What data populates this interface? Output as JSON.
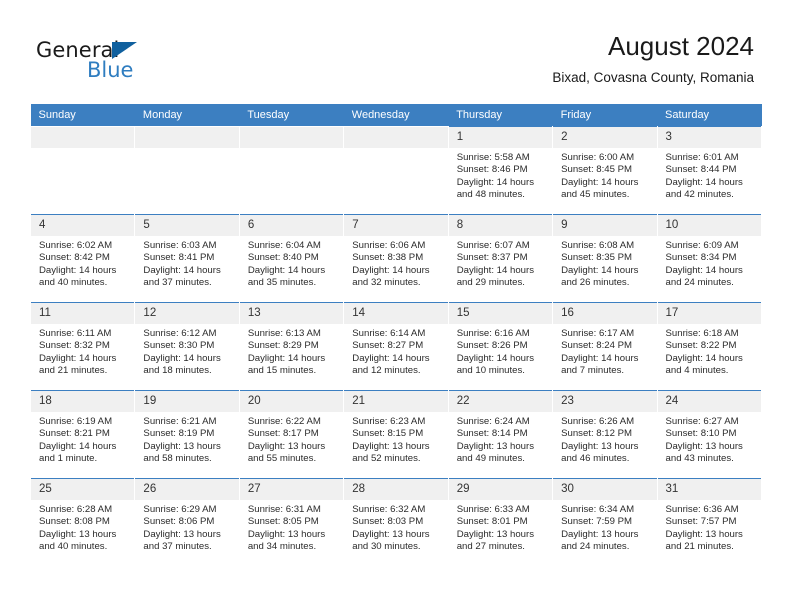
{
  "brand": {
    "name_part1": "General",
    "name_part2": "Blue",
    "logo_icon": "triangle-logo-icon"
  },
  "header": {
    "title": "August 2024",
    "subtitle": "Bixad, Covasna County, Romania"
  },
  "colors": {
    "header_blue": "#3c7fc1",
    "brand_blue": "#2f7dc0",
    "logo_blue": "#10609e",
    "daynum_bg": "#f0f0f0",
    "text": "#2b2b2b"
  },
  "weekdays": [
    "Sunday",
    "Monday",
    "Tuesday",
    "Wednesday",
    "Thursday",
    "Friday",
    "Saturday"
  ],
  "weeks": [
    [
      {
        "day": "",
        "blank": true,
        "sunrise": "",
        "sunset": "",
        "daylight": ""
      },
      {
        "day": "",
        "blank": true,
        "sunrise": "",
        "sunset": "",
        "daylight": ""
      },
      {
        "day": "",
        "blank": true,
        "sunrise": "",
        "sunset": "",
        "daylight": ""
      },
      {
        "day": "",
        "blank": true,
        "sunrise": "",
        "sunset": "",
        "daylight": ""
      },
      {
        "day": "1",
        "sunrise": "Sunrise: 5:58 AM",
        "sunset": "Sunset: 8:46 PM",
        "daylight": "Daylight: 14 hours and 48 minutes."
      },
      {
        "day": "2",
        "sunrise": "Sunrise: 6:00 AM",
        "sunset": "Sunset: 8:45 PM",
        "daylight": "Daylight: 14 hours and 45 minutes."
      },
      {
        "day": "3",
        "sunrise": "Sunrise: 6:01 AM",
        "sunset": "Sunset: 8:44 PM",
        "daylight": "Daylight: 14 hours and 42 minutes."
      }
    ],
    [
      {
        "day": "4",
        "sunrise": "Sunrise: 6:02 AM",
        "sunset": "Sunset: 8:42 PM",
        "daylight": "Daylight: 14 hours and 40 minutes."
      },
      {
        "day": "5",
        "sunrise": "Sunrise: 6:03 AM",
        "sunset": "Sunset: 8:41 PM",
        "daylight": "Daylight: 14 hours and 37 minutes."
      },
      {
        "day": "6",
        "sunrise": "Sunrise: 6:04 AM",
        "sunset": "Sunset: 8:40 PM",
        "daylight": "Daylight: 14 hours and 35 minutes."
      },
      {
        "day": "7",
        "sunrise": "Sunrise: 6:06 AM",
        "sunset": "Sunset: 8:38 PM",
        "daylight": "Daylight: 14 hours and 32 minutes."
      },
      {
        "day": "8",
        "sunrise": "Sunrise: 6:07 AM",
        "sunset": "Sunset: 8:37 PM",
        "daylight": "Daylight: 14 hours and 29 minutes."
      },
      {
        "day": "9",
        "sunrise": "Sunrise: 6:08 AM",
        "sunset": "Sunset: 8:35 PM",
        "daylight": "Daylight: 14 hours and 26 minutes."
      },
      {
        "day": "10",
        "sunrise": "Sunrise: 6:09 AM",
        "sunset": "Sunset: 8:34 PM",
        "daylight": "Daylight: 14 hours and 24 minutes."
      }
    ],
    [
      {
        "day": "11",
        "sunrise": "Sunrise: 6:11 AM",
        "sunset": "Sunset: 8:32 PM",
        "daylight": "Daylight: 14 hours and 21 minutes."
      },
      {
        "day": "12",
        "sunrise": "Sunrise: 6:12 AM",
        "sunset": "Sunset: 8:30 PM",
        "daylight": "Daylight: 14 hours and 18 minutes."
      },
      {
        "day": "13",
        "sunrise": "Sunrise: 6:13 AM",
        "sunset": "Sunset: 8:29 PM",
        "daylight": "Daylight: 14 hours and 15 minutes."
      },
      {
        "day": "14",
        "sunrise": "Sunrise: 6:14 AM",
        "sunset": "Sunset: 8:27 PM",
        "daylight": "Daylight: 14 hours and 12 minutes."
      },
      {
        "day": "15",
        "sunrise": "Sunrise: 6:16 AM",
        "sunset": "Sunset: 8:26 PM",
        "daylight": "Daylight: 14 hours and 10 minutes."
      },
      {
        "day": "16",
        "sunrise": "Sunrise: 6:17 AM",
        "sunset": "Sunset: 8:24 PM",
        "daylight": "Daylight: 14 hours and 7 minutes."
      },
      {
        "day": "17",
        "sunrise": "Sunrise: 6:18 AM",
        "sunset": "Sunset: 8:22 PM",
        "daylight": "Daylight: 14 hours and 4 minutes."
      }
    ],
    [
      {
        "day": "18",
        "sunrise": "Sunrise: 6:19 AM",
        "sunset": "Sunset: 8:21 PM",
        "daylight": "Daylight: 14 hours and 1 minute."
      },
      {
        "day": "19",
        "sunrise": "Sunrise: 6:21 AM",
        "sunset": "Sunset: 8:19 PM",
        "daylight": "Daylight: 13 hours and 58 minutes."
      },
      {
        "day": "20",
        "sunrise": "Sunrise: 6:22 AM",
        "sunset": "Sunset: 8:17 PM",
        "daylight": "Daylight: 13 hours and 55 minutes."
      },
      {
        "day": "21",
        "sunrise": "Sunrise: 6:23 AM",
        "sunset": "Sunset: 8:15 PM",
        "daylight": "Daylight: 13 hours and 52 minutes."
      },
      {
        "day": "22",
        "sunrise": "Sunrise: 6:24 AM",
        "sunset": "Sunset: 8:14 PM",
        "daylight": "Daylight: 13 hours and 49 minutes."
      },
      {
        "day": "23",
        "sunrise": "Sunrise: 6:26 AM",
        "sunset": "Sunset: 8:12 PM",
        "daylight": "Daylight: 13 hours and 46 minutes."
      },
      {
        "day": "24",
        "sunrise": "Sunrise: 6:27 AM",
        "sunset": "Sunset: 8:10 PM",
        "daylight": "Daylight: 13 hours and 43 minutes."
      }
    ],
    [
      {
        "day": "25",
        "sunrise": "Sunrise: 6:28 AM",
        "sunset": "Sunset: 8:08 PM",
        "daylight": "Daylight: 13 hours and 40 minutes."
      },
      {
        "day": "26",
        "sunrise": "Sunrise: 6:29 AM",
        "sunset": "Sunset: 8:06 PM",
        "daylight": "Daylight: 13 hours and 37 minutes."
      },
      {
        "day": "27",
        "sunrise": "Sunrise: 6:31 AM",
        "sunset": "Sunset: 8:05 PM",
        "daylight": "Daylight: 13 hours and 34 minutes."
      },
      {
        "day": "28",
        "sunrise": "Sunrise: 6:32 AM",
        "sunset": "Sunset: 8:03 PM",
        "daylight": "Daylight: 13 hours and 30 minutes."
      },
      {
        "day": "29",
        "sunrise": "Sunrise: 6:33 AM",
        "sunset": "Sunset: 8:01 PM",
        "daylight": "Daylight: 13 hours and 27 minutes."
      },
      {
        "day": "30",
        "sunrise": "Sunrise: 6:34 AM",
        "sunset": "Sunset: 7:59 PM",
        "daylight": "Daylight: 13 hours and 24 minutes."
      },
      {
        "day": "31",
        "sunrise": "Sunrise: 6:36 AM",
        "sunset": "Sunset: 7:57 PM",
        "daylight": "Daylight: 13 hours and 21 minutes."
      }
    ]
  ]
}
